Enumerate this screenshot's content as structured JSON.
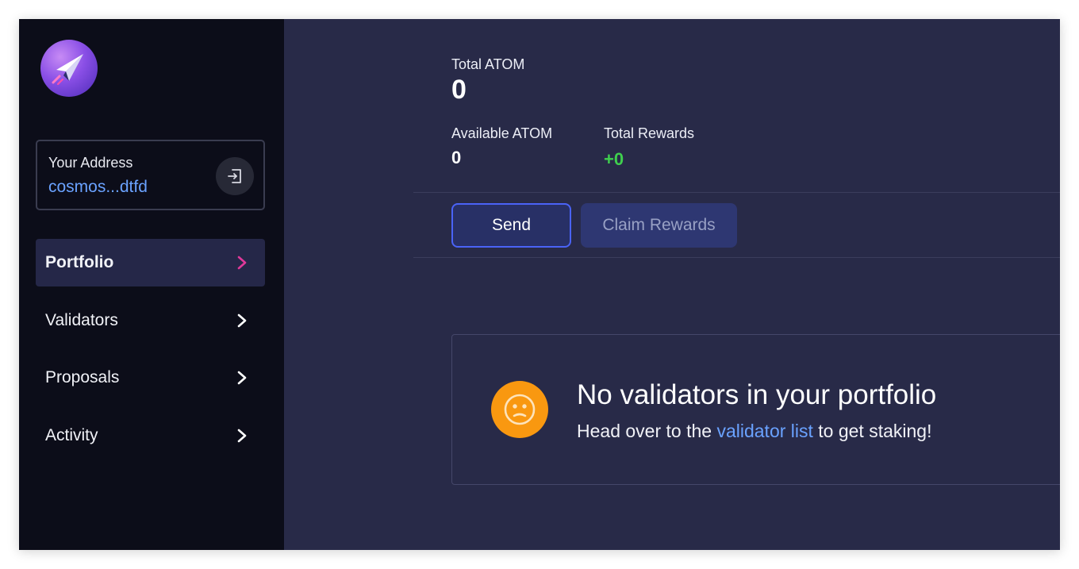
{
  "sidebar": {
    "logo_icon": "paper-plane-icon",
    "address": {
      "label": "Your Address",
      "value": "cosmos...dtfd",
      "signout_icon": "sign-out-icon"
    },
    "nav": [
      {
        "label": "Portfolio",
        "active": true,
        "accent": "#e0399a"
      },
      {
        "label": "Validators",
        "active": false
      },
      {
        "label": "Proposals",
        "active": false
      },
      {
        "label": "Activity",
        "active": false
      }
    ]
  },
  "main": {
    "total": {
      "label": "Total ATOM",
      "value": "0"
    },
    "available": {
      "label": "Available ATOM",
      "value": "0"
    },
    "rewards": {
      "label": "Total Rewards",
      "value": "+0",
      "color": "#3fcf4e"
    },
    "buttons": {
      "send": "Send",
      "claim": "Claim Rewards"
    },
    "empty_state": {
      "icon": "sad-face-icon",
      "title": "No validators in your portfolio",
      "sub_before": "Head over to the",
      "sub_link": "validator list",
      "sub_after": "to get staking!"
    }
  },
  "colors": {
    "sidebar_bg": "#0c0d19",
    "main_bg": "#282a48",
    "link": "#6aa2ff",
    "send_border": "#4a63f7",
    "warning": "#f99810"
  }
}
